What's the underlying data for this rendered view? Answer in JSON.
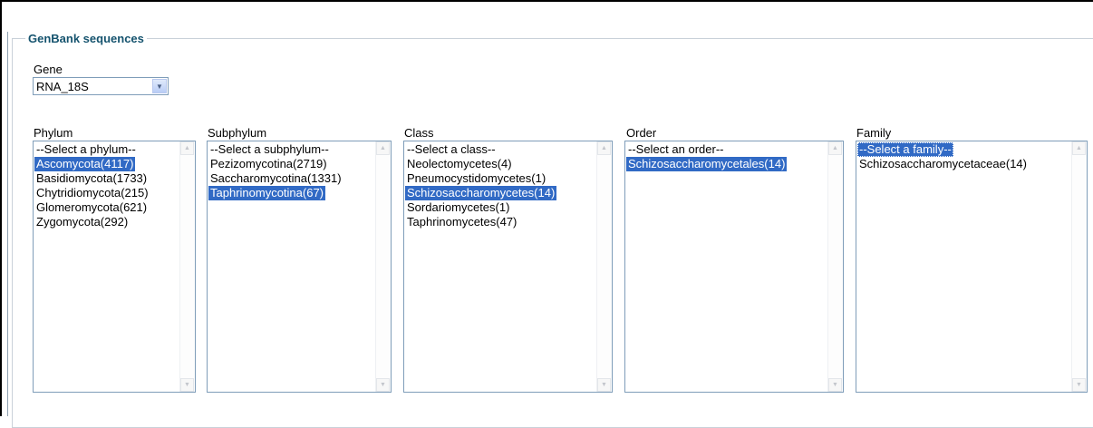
{
  "section": {
    "title": "GenBank sequences"
  },
  "gene": {
    "label": "Gene",
    "selected": "RNA_18S"
  },
  "phylum": {
    "label": "Phylum",
    "options": [
      "--Select a phylum--",
      "Ascomycota(4117)",
      "Basidiomycota(1733)",
      "Chytridiomycota(215)",
      "Glomeromycota(621)",
      "Zygomycota(292)"
    ],
    "selected_index": 1
  },
  "subphylum": {
    "label": "Subphylum",
    "options": [
      "--Select a subphylum--",
      "Pezizomycotina(2719)",
      "Saccharomycotina(1331)",
      "Taphrinomycotina(67)"
    ],
    "selected_index": 3
  },
  "class": {
    "label": "Class",
    "options": [
      "--Select a class--",
      "Neolectomycetes(4)",
      "Pneumocystidomycetes(1)",
      "Schizosaccharomycetes(14)",
      "Sordariomycetes(1)",
      "Taphrinomycetes(47)"
    ],
    "selected_index": 3
  },
  "order": {
    "label": "Order",
    "options": [
      "--Select an order--",
      "Schizosaccharomycetales(14)"
    ],
    "selected_index": 1
  },
  "family": {
    "label": "Family",
    "options": [
      "--Select a family--",
      "Schizosaccharomycetaceae(14)"
    ],
    "selected_index": 0
  },
  "colors": {
    "selection": "#316ac5",
    "legend": "#15536e",
    "border": "#7f9db9"
  }
}
